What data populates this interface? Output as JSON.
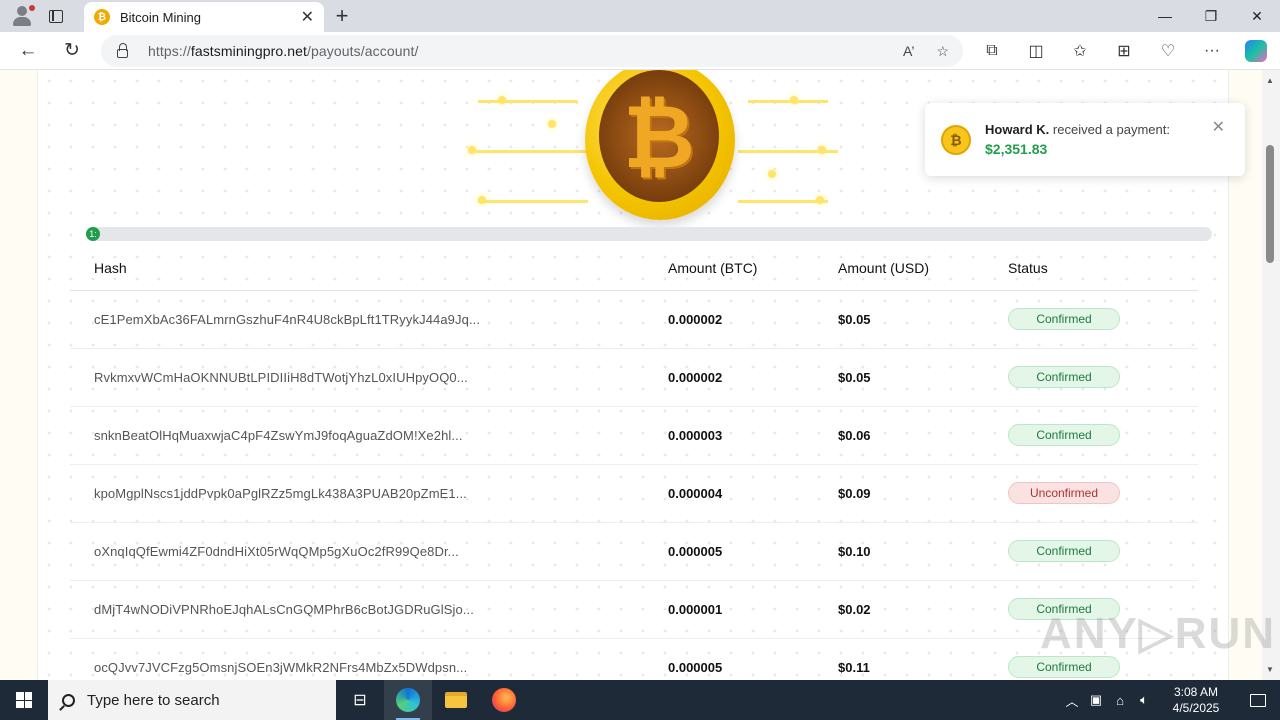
{
  "browser": {
    "tab_title": "Bitcoin Mining",
    "tab_favicon": "₿",
    "url_prefix": "https://",
    "url_domain": "fastsminingpro.net",
    "url_path": "/payouts/account/",
    "read_aloud": "A’"
  },
  "progress": {
    "label": "1:",
    "fraction": 0.01
  },
  "table": {
    "headers": [
      "Hash",
      "Amount (BTC)",
      "Amount (USD)",
      "Status"
    ],
    "rows": [
      {
        "hash": "cE1PemXbAc36FALmrnGszhuF4nR4U8ckBpLft1TRyykJ44a9Jq...",
        "btc": "0.000002",
        "usd": "$0.05",
        "status": "Confirmed"
      },
      {
        "hash": "RvkmxvWCmHaOKNNUBtLPIDIIiH8dTWotjYhzL0xIUHpyOQ0...",
        "btc": "0.000002",
        "usd": "$0.05",
        "status": "Confirmed"
      },
      {
        "hash": "snknBeatOlHqMuaxwjaC4pF4ZswYmJ9foqAguaZdOM!Xe2hl...",
        "btc": "0.000003",
        "usd": "$0.06",
        "status": "Confirmed"
      },
      {
        "hash": "kpoMgplNscs1jddPvpk0aPglRZz5mgLk438A3PUAB20pZmE1...",
        "btc": "0.000004",
        "usd": "$0.09",
        "status": "Unconfirmed"
      },
      {
        "hash": "oXnqIqQfEwmi4ZF0dndHiXt05rWqQMp5gXuOc2fR99Qe8Dr...",
        "btc": "0.000005",
        "usd": "$0.10",
        "status": "Confirmed"
      },
      {
        "hash": "dMjT4wNODiVPNRhoEJqhALsCnGQMPhrB6cBotJGDRuGlSjo...",
        "btc": "0.000001",
        "usd": "$0.02",
        "status": "Confirmed"
      },
      {
        "hash": "ocQJvv7JVCFzg5OmsnjSOEn3jWMkR2NFrs4MbZx5DWdpsn...",
        "btc": "0.000005",
        "usd": "$0.11",
        "status": "Confirmed"
      }
    ]
  },
  "toast": {
    "name": "Howard K.",
    "message": " received a payment:",
    "amount": "$2,351.83",
    "close": "✕"
  },
  "watermark": "ANY▷RUN",
  "taskbar": {
    "search_placeholder": "Type here to search",
    "time": "3:08 AM",
    "date": "4/5/2025"
  }
}
